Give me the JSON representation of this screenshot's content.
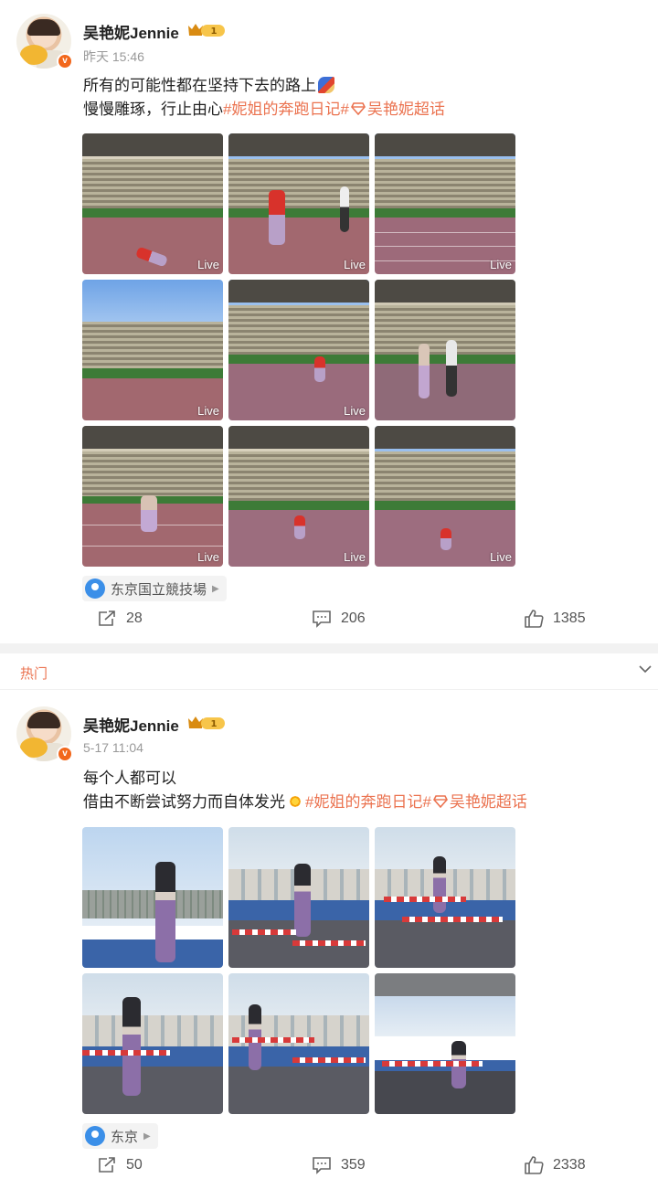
{
  "posts": [
    {
      "username": "吴艳妮Jennie",
      "vip_level": "1",
      "verified_badge": "v",
      "timestamp": "昨天 15:46",
      "text_line1": "所有的可能性都在坚持下去的路上",
      "text_line2_prefix": "慢慢雕琢，行止由心",
      "tag1": "#妮姐的奔跑日记#",
      "tag2": "吴艳妮超话",
      "photo_badge": "Live",
      "location": "东京国立競技場",
      "reposts": "28",
      "comments": "206",
      "likes": "1385"
    },
    {
      "username": "吴艳妮Jennie",
      "vip_level": "1",
      "verified_badge": "v",
      "timestamp": "5-17 11:04",
      "text_line1": "每个人都可以",
      "text_line2_prefix": "借由不断尝试努力而自体发光",
      "tag1": "#妮姐的奔跑日记#",
      "tag2": "吴艳妮超话",
      "location": "东京",
      "reposts": "50",
      "comments": "359",
      "likes": "2338"
    }
  ],
  "section": {
    "hot_label": "热门"
  },
  "colors": {
    "tag": "#eb7350",
    "verified": "#f2671b",
    "location_pin": "#3b8fe8"
  },
  "icons": [
    "repost-icon",
    "comment-icon",
    "like-icon",
    "location-pin-icon",
    "crown-icon",
    "chevron-down-icon",
    "runner-emoji",
    "sparkle-emoji"
  ]
}
